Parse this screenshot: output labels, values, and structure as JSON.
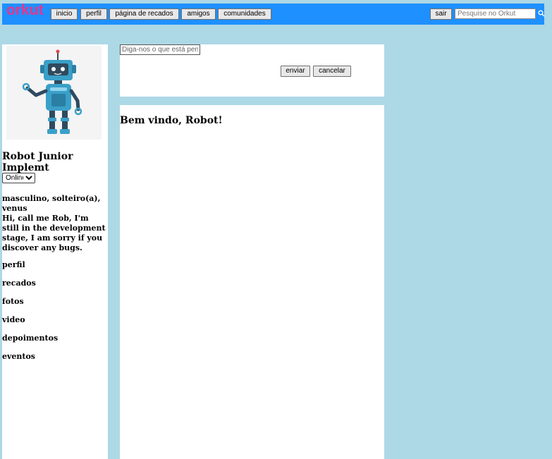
{
  "header": {
    "logo": "orkut",
    "nav": [
      "inicio",
      "perfil",
      "página de recados",
      "amigos",
      "comunidades"
    ],
    "logout_label": "sair",
    "search_placeholder": "Pesquise no Orkut",
    "search_icon": "magnifier-icon",
    "logo_color": "#e8348f",
    "bar_color": "#1e90ff"
  },
  "profile": {
    "avatar_icon": "robot-avatar",
    "name": "Robot Junior Implemt",
    "status_selected": "Online",
    "details": "masculino, solteiro(a), venus",
    "bio": "Hi, call me Rob, I'm still in the development stage, I am sorry if you discover any bugs."
  },
  "sidebar": {
    "items": [
      "perfil",
      "recados",
      "fotos",
      "video",
      "depoimentos",
      "eventos"
    ]
  },
  "compose": {
    "placeholder": "Diga-nos o que está pensando...",
    "send_label": "enviar",
    "cancel_label": "cancelar"
  },
  "feed": {
    "welcome": "Bem vindo, Robot!"
  },
  "colors": {
    "page_background": "#add8e6",
    "panel_background": "#ffffff"
  }
}
